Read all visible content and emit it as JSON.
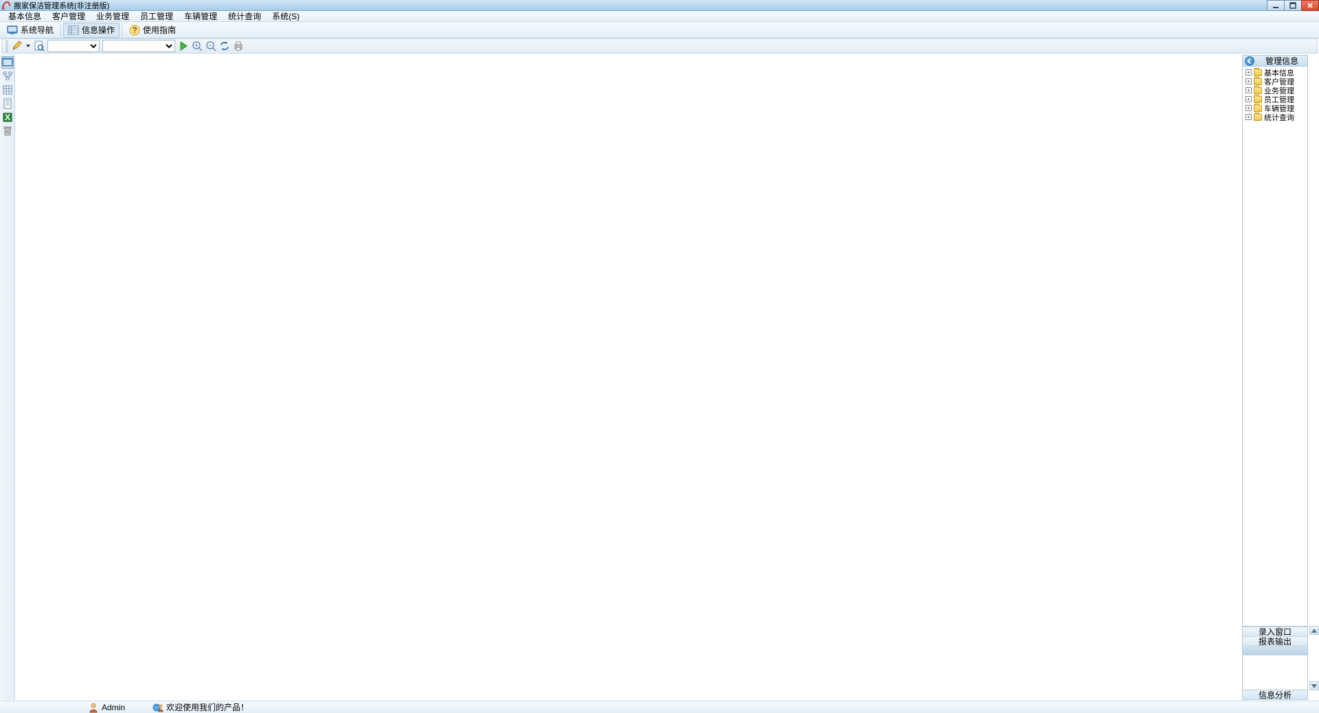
{
  "window": {
    "title": "搬家保洁管理系统(非注册版)"
  },
  "menu": {
    "items": [
      "基本信息",
      "客户管理",
      "业务管理",
      "员工管理",
      "车辆管理",
      "统计查询",
      "系统(S)"
    ]
  },
  "toolbar1": {
    "nav_label": "系统导航",
    "info_label": "信息操作",
    "guide_label": "使用指南"
  },
  "rightpanel": {
    "title": "管理信息",
    "tree": [
      "基本信息",
      "客户管理",
      "业务管理",
      "员工管理",
      "车辆管理",
      "统计查询"
    ],
    "tab_entry": "录入窗口",
    "tab_report": "报表输出",
    "analysis": "信息分析"
  },
  "status": {
    "user": "Admin",
    "welcome": "欢迎使用我们的产品！"
  }
}
